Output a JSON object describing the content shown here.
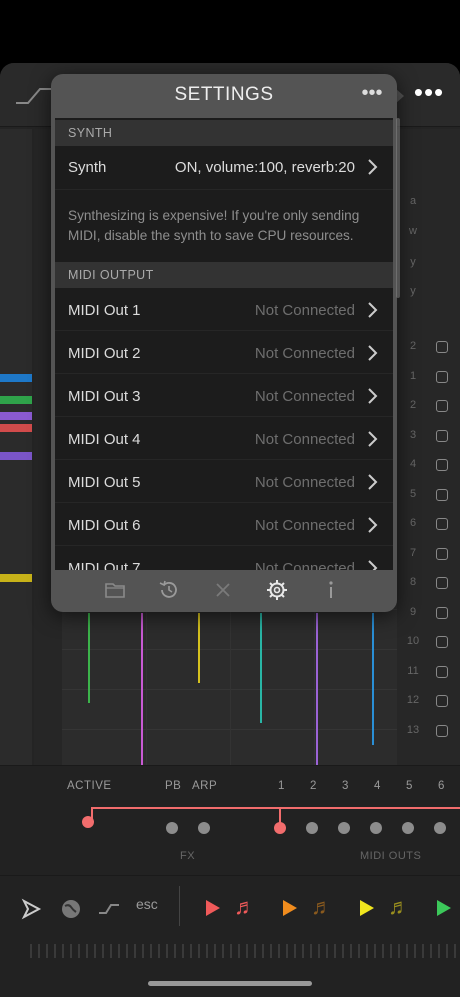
{
  "popup": {
    "title": "SETTINGS",
    "sections": [
      {
        "header": "SYNTH",
        "rows": [
          {
            "label": "Synth",
            "value": "ON, volume:100, reverb:20"
          }
        ],
        "note": "Synthesizing is expensive! If you're only sending MIDI, disable the synth to save CPU resources."
      },
      {
        "header": "MIDI OUTPUT",
        "rows": [
          {
            "label": "MIDI Out 1",
            "value": "Not Connected"
          },
          {
            "label": "MIDI Out 2",
            "value": "Not Connected"
          },
          {
            "label": "MIDI Out 3",
            "value": "Not Connected"
          },
          {
            "label": "MIDI Out 4",
            "value": "Not Connected"
          },
          {
            "label": "MIDI Out 5",
            "value": "Not Connected"
          },
          {
            "label": "MIDI Out 6",
            "value": "Not Connected"
          },
          {
            "label": "MIDI Out 7",
            "value": "Not Connected"
          }
        ]
      }
    ],
    "toolbar_icons": [
      "folder-icon",
      "history-icon",
      "close-icon",
      "gear-icon",
      "info-icon"
    ]
  },
  "controls": {
    "active_label": "ACTIVE",
    "pb_label": "PB",
    "arp_label": "ARP",
    "fx_label": "FX",
    "midi_outs_label": "MIDI OUTS",
    "channels": [
      "1",
      "2",
      "3",
      "4",
      "5",
      "6"
    ]
  },
  "right_column": {
    "letters": [
      "a",
      "w",
      "y",
      "y"
    ],
    "numbers": [
      "2",
      "1",
      "2",
      "3",
      "4",
      "5",
      "6",
      "7",
      "8",
      "9",
      "10",
      "11",
      "12",
      "13"
    ]
  },
  "bottombar": {
    "esc_label": "esc",
    "track_colors": [
      "#f05a5a",
      "#f08c1e",
      "#f0e61e",
      "#3cc85a"
    ]
  },
  "colors": {
    "accent_red": "#f26d6d",
    "popup_bg": "#545454",
    "content_bg": "#1c1c1c"
  }
}
